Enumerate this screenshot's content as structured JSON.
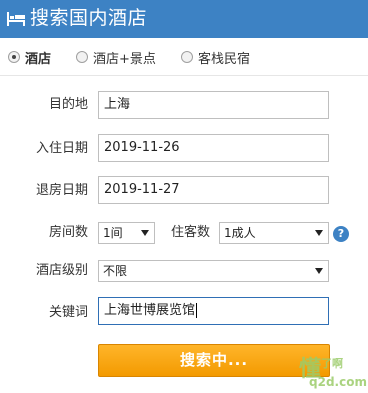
{
  "header": {
    "title": "搜索国内酒店",
    "icon": "bed-icon",
    "bg_color": "#3d82c4"
  },
  "tabs": [
    {
      "label": "酒店",
      "selected": true
    },
    {
      "label": "酒店+景点",
      "selected": false
    },
    {
      "label": "客栈民宿",
      "selected": false
    }
  ],
  "form": {
    "destination": {
      "label": "目的地",
      "value": "上海"
    },
    "checkin": {
      "label": "入住日期",
      "value": "2019-11-26"
    },
    "checkout": {
      "label": "退房日期",
      "value": "2019-11-27"
    },
    "rooms": {
      "label": "房间数",
      "value": "1间"
    },
    "guests": {
      "label": "住客数",
      "value": "1成人"
    },
    "help": "?",
    "star": {
      "label": "酒店级别",
      "value": "不限"
    },
    "keyword": {
      "label": "关键词",
      "value": "上海世博展览馆"
    }
  },
  "search_button": {
    "label": "搜索中...",
    "color": "#f5a300"
  },
  "watermark": {
    "char": "懂",
    "small": "了啊",
    "domain": "q2d.com"
  }
}
